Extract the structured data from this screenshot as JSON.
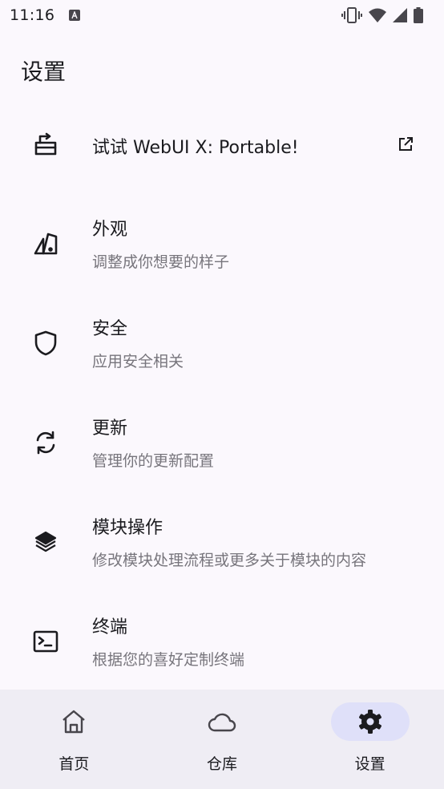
{
  "status_bar": {
    "time": "11:16",
    "notification_icon": "a-badge-icon",
    "icons": [
      "vibrate-icon",
      "wifi-icon",
      "signal-icon",
      "battery-icon"
    ]
  },
  "page": {
    "title": "设置"
  },
  "items": [
    {
      "title": "试试 WebUI X: Portable!",
      "subtitle": null,
      "icon": "tray-arrow-icon",
      "trailing_icon": "external-link-icon"
    },
    {
      "title": "外观",
      "subtitle": "调整成你想要的样子",
      "icon": "palette-shapes-icon"
    },
    {
      "title": "安全",
      "subtitle": "应用安全相关",
      "icon": "shield-icon"
    },
    {
      "title": "更新",
      "subtitle": "管理你的更新配置",
      "icon": "refresh-icon"
    },
    {
      "title": "模块操作",
      "subtitle": "修改模块处理流程或更多关于模块的内容",
      "icon": "layers-icon"
    },
    {
      "title": "终端",
      "subtitle": "根据您的喜好定制终端",
      "icon": "terminal-icon"
    }
  ],
  "bottom_nav": {
    "items": [
      {
        "label": "首页",
        "icon": "home-icon",
        "active": false
      },
      {
        "label": "仓库",
        "icon": "cloud-icon",
        "active": false
      },
      {
        "label": "设置",
        "icon": "gear-icon",
        "active": true
      }
    ]
  },
  "colors": {
    "background": "#fbf8fd",
    "nav_background": "#efedf4",
    "active_pill": "#dfe0f9",
    "text_primary": "#1b1b1f",
    "text_secondary": "#77757c"
  }
}
